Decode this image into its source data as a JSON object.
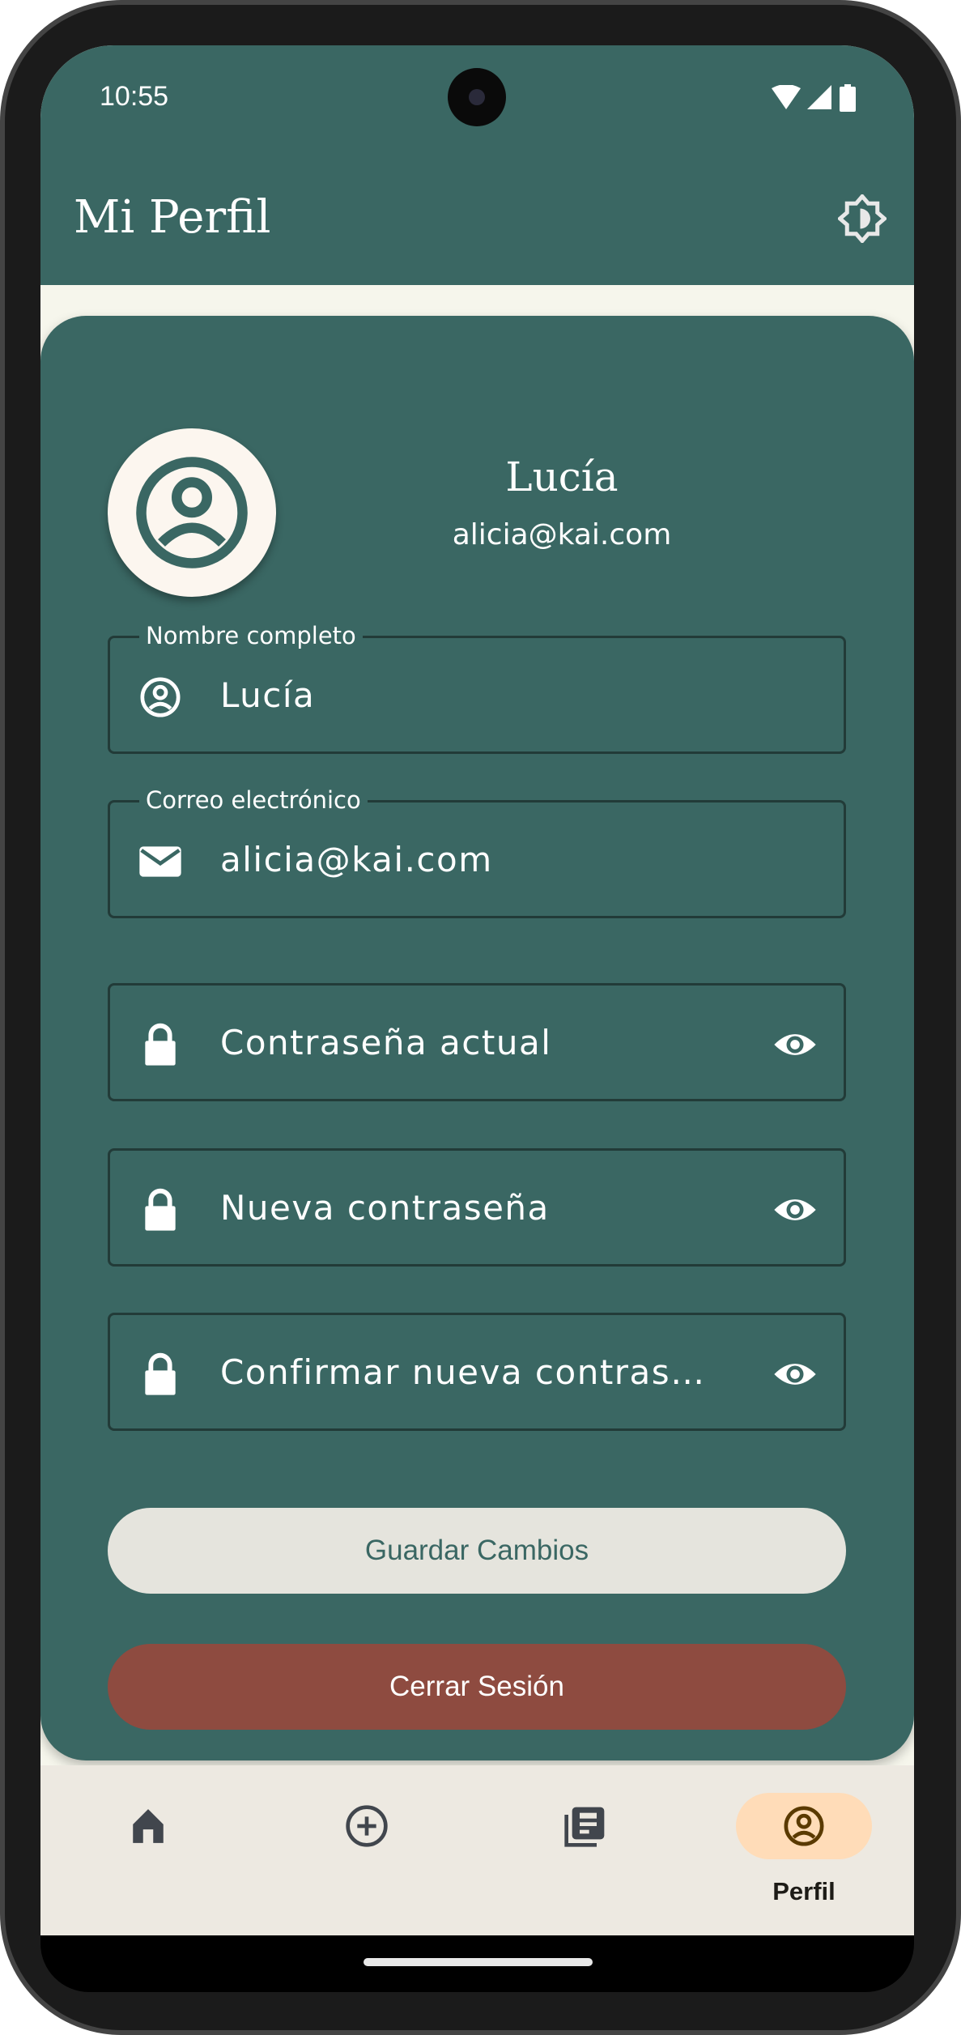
{
  "status_bar": {
    "time": "10:55"
  },
  "app_bar": {
    "title": "Mi Perfil",
    "theme_icon": "brightness-icon"
  },
  "profile": {
    "name": "Lucía",
    "email": "alicia@kai.com"
  },
  "form": {
    "full_name": {
      "label": "Nombre completo",
      "value": "Lucía",
      "icon": "account-circle-icon"
    },
    "email": {
      "label": "Correo electrónico",
      "value": "alicia@kai.com",
      "icon": "mail-icon"
    },
    "current_password": {
      "placeholder": "Contraseña actual",
      "icon": "lock-icon"
    },
    "new_password": {
      "placeholder": "Nueva contraseña",
      "icon": "lock-icon"
    },
    "confirm_password": {
      "placeholder": "Confirmar nueva contras…",
      "icon": "lock-icon"
    }
  },
  "buttons": {
    "save": "Guardar Cambios",
    "logout": "Cerrar Sesión"
  },
  "nav": {
    "items": [
      {
        "icon": "home-icon",
        "label": ""
      },
      {
        "icon": "add-circle-icon",
        "label": ""
      },
      {
        "icon": "library-icon",
        "label": ""
      },
      {
        "icon": "account-circle-icon",
        "label": "Perfil",
        "active": true
      }
    ]
  },
  "colors": {
    "primary": "#3a6763",
    "background": "#f6f6ec",
    "danger": "#8e4b40",
    "nav_active": "#ffdcb8"
  }
}
